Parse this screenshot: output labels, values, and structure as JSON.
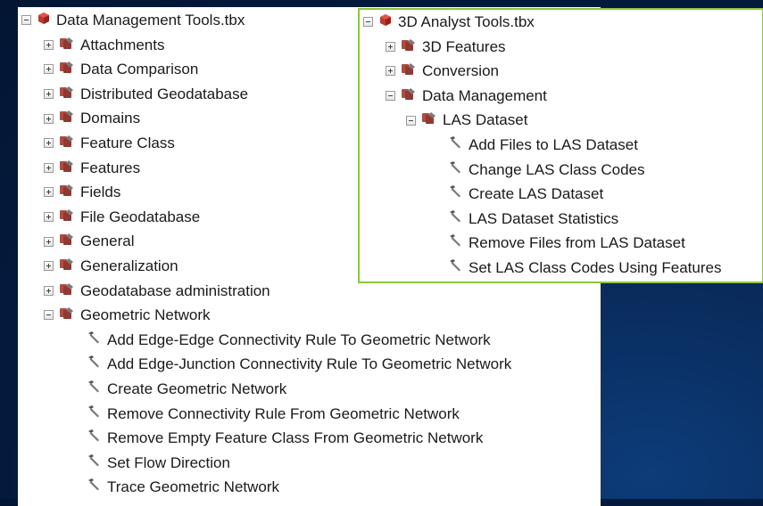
{
  "left_panel": {
    "root": {
      "label": "Data Management Tools.tbx",
      "icon": "toolbox-icon",
      "state": "expanded"
    },
    "toolsets": [
      {
        "label": "Attachments",
        "icon": "toolset-icon",
        "state": "collapsed"
      },
      {
        "label": "Data Comparison",
        "icon": "toolset-icon",
        "state": "collapsed"
      },
      {
        "label": "Distributed Geodatabase",
        "icon": "toolset-icon",
        "state": "collapsed"
      },
      {
        "label": "Domains",
        "icon": "toolset-icon",
        "state": "collapsed"
      },
      {
        "label": "Feature Class",
        "icon": "toolset-icon",
        "state": "collapsed"
      },
      {
        "label": "Features",
        "icon": "toolset-icon",
        "state": "collapsed"
      },
      {
        "label": "Fields",
        "icon": "toolset-icon",
        "state": "collapsed"
      },
      {
        "label": "File Geodatabase",
        "icon": "toolset-icon",
        "state": "collapsed"
      },
      {
        "label": "General",
        "icon": "toolset-icon",
        "state": "collapsed"
      },
      {
        "label": "Generalization",
        "icon": "toolset-icon",
        "state": "collapsed"
      },
      {
        "label": "Geodatabase administration",
        "icon": "toolset-icon",
        "state": "collapsed"
      },
      {
        "label": "Geometric Network",
        "icon": "toolset-icon",
        "state": "expanded"
      }
    ],
    "tools": [
      {
        "label": "Add Edge-Edge Connectivity Rule To Geometric Network",
        "icon": "hammer-icon"
      },
      {
        "label": "Add Edge-Junction Connectivity Rule To Geometric Network",
        "icon": "hammer-icon"
      },
      {
        "label": "Create Geometric Network",
        "icon": "hammer-icon"
      },
      {
        "label": "Remove Connectivity Rule From Geometric Network",
        "icon": "hammer-icon"
      },
      {
        "label": "Remove Empty Feature Class From Geometric Network",
        "icon": "hammer-icon"
      },
      {
        "label": "Set Flow Direction",
        "icon": "hammer-icon"
      },
      {
        "label": "Trace Geometric Network",
        "icon": "hammer-icon"
      }
    ]
  },
  "right_panel": {
    "root": {
      "label": "3D Analyst Tools.tbx",
      "icon": "toolbox-icon",
      "state": "expanded"
    },
    "toolsets": [
      {
        "label": "3D Features",
        "icon": "toolset-icon",
        "state": "collapsed"
      },
      {
        "label": "Conversion",
        "icon": "toolset-icon",
        "state": "collapsed"
      },
      {
        "label": "Data Management",
        "icon": "toolset-icon",
        "state": "expanded"
      }
    ],
    "subtoolset": {
      "label": "LAS Dataset",
      "icon": "toolset-icon",
      "state": "expanded"
    },
    "tools": [
      {
        "label": "Add Files to LAS Dataset",
        "icon": "hammer-icon"
      },
      {
        "label": "Change LAS Class Codes",
        "icon": "hammer-icon"
      },
      {
        "label": "Create LAS Dataset",
        "icon": "hammer-icon"
      },
      {
        "label": "LAS Dataset Statistics",
        "icon": "hammer-icon"
      },
      {
        "label": "Remove Files from LAS Dataset",
        "icon": "hammer-icon"
      },
      {
        "label": "Set LAS Class Codes Using Features",
        "icon": "hammer-icon"
      }
    ]
  },
  "colors": {
    "background": "#041a3d",
    "panel_border_accent": "#8cc63f",
    "toolbox_red": "#b8352e",
    "toolset_red": "#a8423a"
  }
}
